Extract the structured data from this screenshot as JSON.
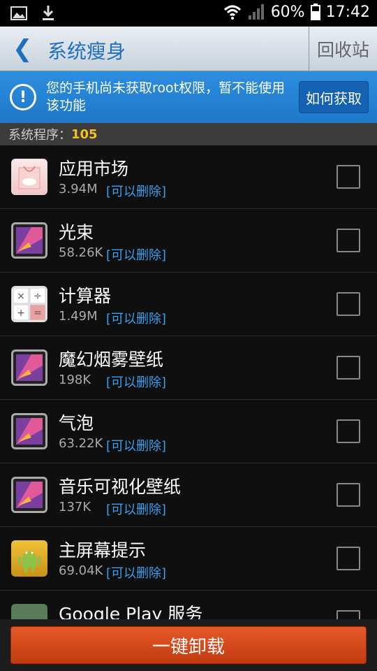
{
  "status_bar": {
    "battery": "60%",
    "time": "17:42"
  },
  "header": {
    "back_label": "❮",
    "title": "系统瘦身",
    "recycle_label": "回收站"
  },
  "notice": {
    "icon": "!",
    "text": "您的手机尚未获取root权限，暂不能使用该功能",
    "button": "如何获取"
  },
  "count": {
    "label": "系统程序：",
    "value": "105"
  },
  "apps": [
    {
      "name": " 应用市场",
      "size": "3.94M",
      "tag": "[可以删除]",
      "icon": "market-icon"
    },
    {
      "name": "光束",
      "size": "58.26K",
      "tag": "[可以删除]",
      "icon": "gallery-icon"
    },
    {
      "name": "计算器",
      "size": "1.49M",
      "tag": "[可以删除]",
      "icon": "calculator-icon"
    },
    {
      "name": "魔幻烟雾壁纸",
      "size": "198K",
      "tag": "[可以删除]",
      "icon": "gallery-icon"
    },
    {
      "name": "气泡",
      "size": "63.22K",
      "tag": "[可以删除]",
      "icon": "gallery-icon"
    },
    {
      "name": "音乐可视化壁纸",
      "size": "137K",
      "tag": "[可以删除]",
      "icon": "gallery-icon"
    },
    {
      "name": "主屏幕提示",
      "size": "69.04K",
      "tag": "[可以删除]",
      "icon": "android-icon"
    },
    {
      "name": "Google Play 服务",
      "size": "",
      "tag": "",
      "icon": "puzzle-icon"
    }
  ],
  "bottom": {
    "uninstall_label": "一键卸载"
  },
  "colors": {
    "accent": "#1e6fc0",
    "notice": "#2d8ee0",
    "tag": "#39a0f0",
    "count": "#f2c21a",
    "button": "#d84a1c"
  }
}
